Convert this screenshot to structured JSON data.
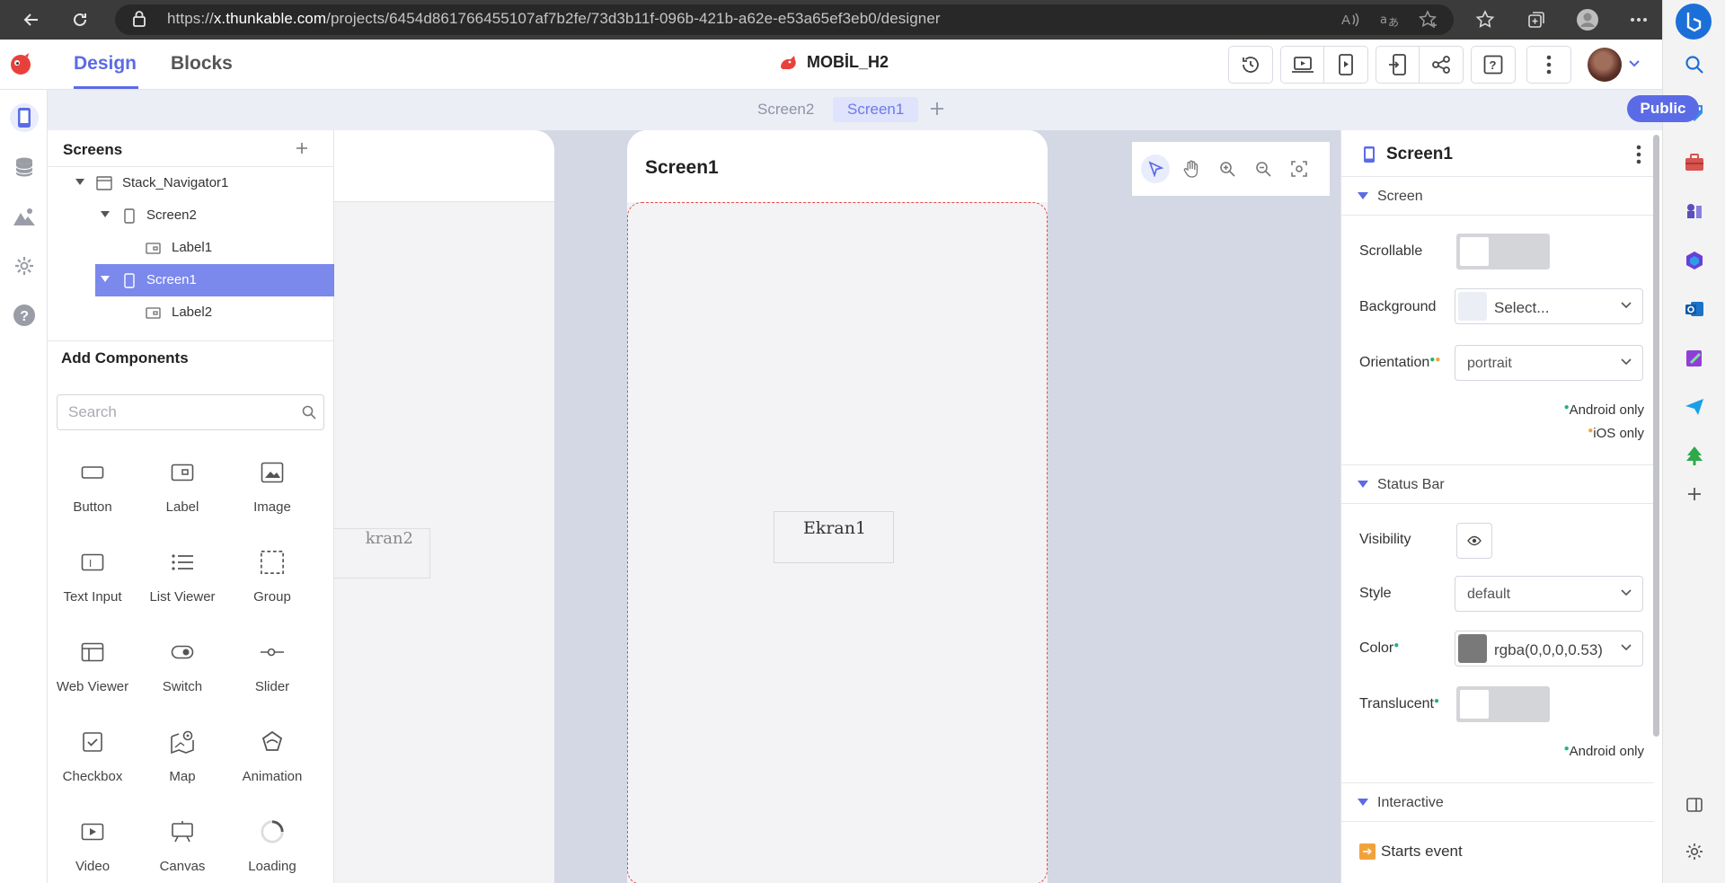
{
  "browser": {
    "url_scheme": "https://",
    "url_host": "x.thunkable.com",
    "url_path": "/projects/6454d861766455107af7b2fe/73d3b11f-096b-421b-a62e-e53a65ef3eb0/designer"
  },
  "header": {
    "tabs": {
      "design": "Design",
      "blocks": "Blocks"
    },
    "project_title": "MOBİL_H2",
    "accent_color": "#5b6be6"
  },
  "screen_tabs": {
    "screen2": "Screen2",
    "screen1": "Screen1",
    "public_label": "Public"
  },
  "screens_panel": {
    "title": "Screens",
    "tree": {
      "navigator": "Stack_Navigator1",
      "screen2": "Screen2",
      "label1": "Label1",
      "screen1": "Screen1",
      "label2": "Label2"
    }
  },
  "components_panel": {
    "title": "Add Components",
    "search_placeholder": "Search",
    "items": {
      "button": "Button",
      "label": "Label",
      "image": "Image",
      "text_input": "Text Input",
      "list_viewer": "List Viewer",
      "group": "Group",
      "web_viewer": "Web Viewer",
      "switch": "Switch",
      "slider": "Slider",
      "checkbox": "Checkbox",
      "map": "Map",
      "animation": "Animation",
      "video": "Video",
      "canvas": "Canvas",
      "loading": "Loading"
    }
  },
  "canvas": {
    "screen2_label": "kran2",
    "screen1_title": "Screen1",
    "screen1_label": "Ekran1"
  },
  "properties": {
    "title": "Screen1",
    "sections": {
      "screen": "Screen",
      "status_bar": "Status Bar",
      "interactive": "Interactive"
    },
    "scrollable_label": "Scrollable",
    "background_label": "Background",
    "background_value": "Select...",
    "orientation_label": "Orientation",
    "orientation_value": "portrait",
    "android_only_note": "Android only",
    "ios_only_note": "iOS only",
    "visibility_label": "Visibility",
    "style_label": "Style",
    "style_value": "default",
    "color_label": "Color",
    "color_value": "rgba(0,0,0,0.53)",
    "translucent_label": "Translucent",
    "translucent_note": "Android only",
    "starts_event_label": "Starts event"
  }
}
